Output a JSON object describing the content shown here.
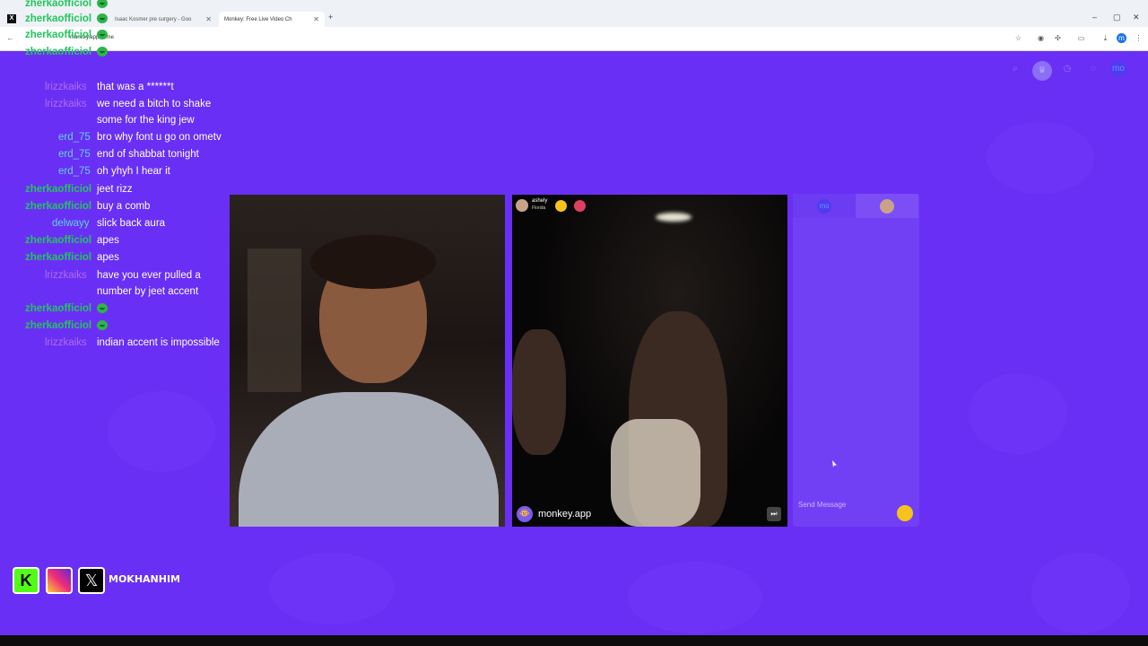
{
  "browser": {
    "tabs": [
      {
        "label": "Isaac Kosmer pre surgery - Goo"
      },
      {
        "label": "Monkey: Free Live Video Ch"
      }
    ],
    "new_tab": "+",
    "url": "monkey.app/home",
    "controls": {
      "minimize": "–",
      "maximize": "▢",
      "close": "✕"
    }
  },
  "chat": {
    "messages": [
      {
        "user": "zherkaofficiol",
        "text": "",
        "emote": true,
        "user_color": "#22c55e"
      },
      {
        "user": "zherkaofficiol",
        "text": "",
        "emote": true,
        "user_color": "#22c55e"
      },
      {
        "user": "zherkaofficiol",
        "text": "",
        "emote": true,
        "user_color": "#22c55e"
      },
      {
        "user": "zherkaofficiol",
        "text": "",
        "emote": true,
        "user_color": "#22c55e"
      },
      {
        "user": "lrizzkaiks",
        "text": "that was a ******t",
        "user_color": "#b06cf0"
      },
      {
        "user": "lrizzkaiks",
        "text": "we need a bitch to shake some for the king jew",
        "user_color": "#b06cf0"
      },
      {
        "user": "erd_75",
        "text": "bro why font u go on ometv",
        "user_color": "#5fd3e8"
      },
      {
        "user": "erd_75",
        "text": "end of shabbat tonight",
        "user_color": "#5fd3e8"
      },
      {
        "user": "erd_75",
        "text": "oh yhyh I hear it",
        "user_color": "#5fd3e8"
      },
      {
        "user": "zherkaofficiol",
        "text": "jeet rizz",
        "user_color": "#22c55e"
      },
      {
        "user": "zherkaofficiol",
        "text": "buy a comb",
        "user_color": "#22c55e"
      },
      {
        "user": "delwayy",
        "text": "slick back aura",
        "user_color": "#5fd3e8"
      },
      {
        "user": "zherkaofficiol",
        "text": "apes",
        "user_color": "#22c55e"
      },
      {
        "user": "zherkaofficiol",
        "text": "apes",
        "user_color": "#22c55e"
      },
      {
        "user": "lrizzkaiks",
        "text": "have you ever pulled a number by jeet accent",
        "user_color": "#b06cf0"
      },
      {
        "user": "zherkaofficiol",
        "text": "",
        "emote": true,
        "user_color": "#22c55e"
      },
      {
        "user": "zherkaofficiol",
        "text": "",
        "emote": true,
        "user_color": "#22c55e"
      },
      {
        "user": "lrizzkaiks",
        "text": "indian accent is impossible",
        "user_color": "#b06cf0"
      }
    ]
  },
  "remote": {
    "name": "ashely",
    "location": "Florida",
    "watermark": "monkey.app"
  },
  "panel": {
    "tab_me": "mo",
    "message_placeholder": "Send Message"
  },
  "streamer": {
    "handle": "MOKHANHIM"
  },
  "colors": {
    "background": "#6a2ff5",
    "panel": "#7240f4",
    "accent_gift": "#f5c31b",
    "kick_green": "#53fc18"
  }
}
